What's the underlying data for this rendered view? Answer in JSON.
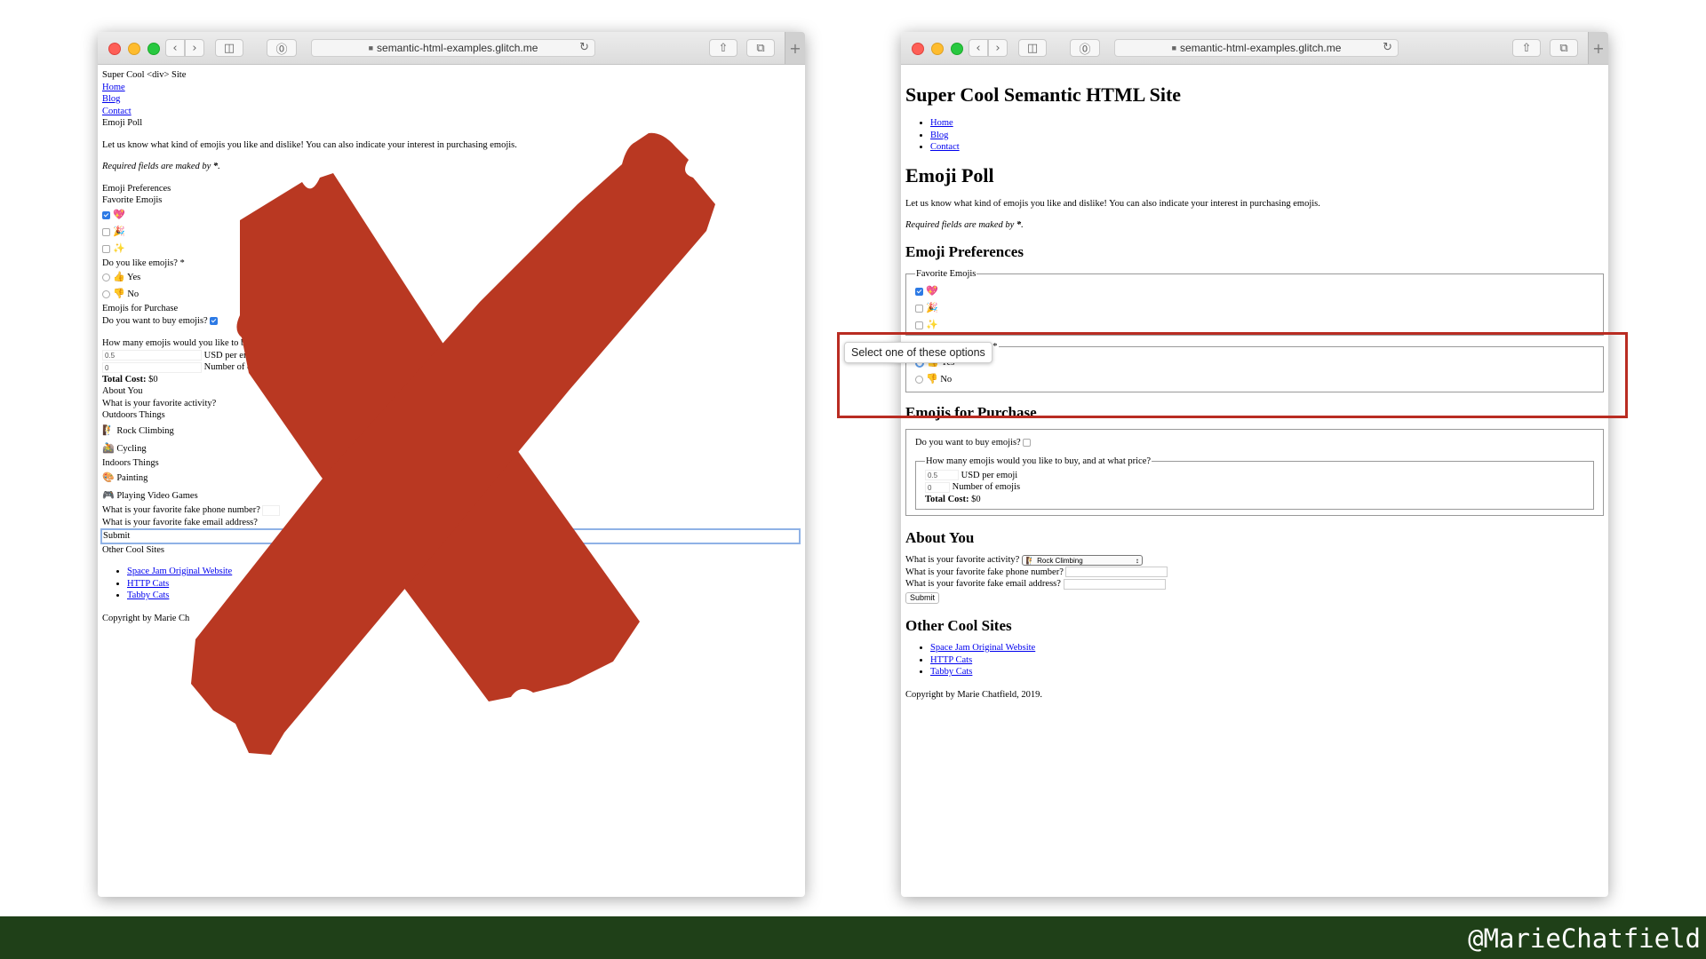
{
  "browser": {
    "url": "semantic-html-examples.glitch.me",
    "back": "‹",
    "forward": "›",
    "sidebar_icon": "◫",
    "privacy_icon": "⓪",
    "reload_icon": "↻",
    "share_icon": "⇧",
    "tabs_icon": "⧉",
    "new_tab": "+"
  },
  "left": {
    "site_title": "Super Cool <div> Site",
    "nav": [
      "Home",
      "Blog",
      "Contact"
    ],
    "poll_title": "Emoji Poll",
    "intro": "Let us know what kind of emojis you like and dislike! You can also indicate your interest in purchasing emojis.",
    "required_note": "Required fields are maked by ",
    "required_star": "*",
    "required_end": ".",
    "prefs_heading": "Emoji Preferences",
    "favorite_label": "Favorite Emojis",
    "emojis": [
      "💖",
      "🎉",
      "✨"
    ],
    "like_question": "Do you like emojis? *",
    "yes_icon": "👍",
    "yes": "Yes",
    "no_icon": "👎",
    "no": "No",
    "purchase_heading": "Emojis for Purchase",
    "buy_question": "Do you want to buy emojis?",
    "how_many": "How many emojis would you like to buy, and",
    "price_value": "0.5",
    "price_unit": "USD per emoji",
    "count_value": "0",
    "count_unit": "Number of emojis",
    "total_label": "Total Cost:",
    "total_value": " $0",
    "about_heading": "About You",
    "activity_question": "What is your favorite activity?",
    "outdoor_heading": "Outdoors Things",
    "activities_outdoor": [
      {
        "icon": "🧗",
        "label": "Rock Climbing"
      },
      {
        "icon": "🚵",
        "label": "Cycling"
      }
    ],
    "indoor_heading": "Indoors Things",
    "activities_indoor": [
      {
        "icon": "🎨",
        "label": "Painting"
      },
      {
        "icon": "🎮",
        "label": "Playing Video Games"
      }
    ],
    "phone_question": "What is your favorite fake phone number?",
    "email_question": "What is your favorite fake email address?",
    "submit": "Submit",
    "other_sites_heading": "Other Cool Sites",
    "other_sites": [
      "Space Jam Original Website",
      "HTTP Cats",
      "Tabby Cats"
    ],
    "copyright": "Copyright by Marie Ch"
  },
  "right": {
    "site_title": "Super Cool Semantic HTML Site",
    "nav": [
      "Home",
      "Blog",
      "Contact"
    ],
    "poll_title": "Emoji Poll",
    "intro": "Let us know what kind of emojis you like and dislike! You can also indicate your interest in purchasing emojis.",
    "required_note": "Required fields are maked by ",
    "required_star": "*",
    "required_end": ".",
    "prefs_heading": "Emoji Preferences",
    "favorite_legend": "Favorite Emojis",
    "emojis": [
      "💖",
      "🎉",
      "✨"
    ],
    "like_legend_tail": "? *",
    "yes_icon": "👍",
    "yes": "Yes",
    "no_icon": "👎",
    "no": "No",
    "purchase_heading": "Emojis for Purchase",
    "buy_question": "Do you want to buy emojis?",
    "how_many_legend": "How many emojis would you like to buy, and at what price?",
    "price_value": "0.5",
    "price_unit": "USD per emoji",
    "count_value": "0",
    "count_unit": "Number of emojis",
    "total_label": "Total Cost:",
    "total_value": " $0",
    "about_heading": "About You",
    "activity_question": "What is your favorite activity?",
    "activity_selected": "🧗 Rock Climbing",
    "phone_question": "What is your favorite fake phone number?",
    "email_question": "What is your favorite fake email address?",
    "submit": "Submit",
    "other_sites_heading": "Other Cool Sites",
    "other_sites": [
      "Space Jam Original Website",
      "HTTP Cats",
      "Tabby Cats"
    ],
    "copyright": "Copyright by Marie Chatfield, 2019.",
    "tooltip": "Select one of these options"
  },
  "handle": "@MarieChatfield",
  "colors": {
    "cross": "#b93822",
    "highlight": "#b92c22",
    "footer": "#1f4018",
    "link": "#0000ee"
  }
}
